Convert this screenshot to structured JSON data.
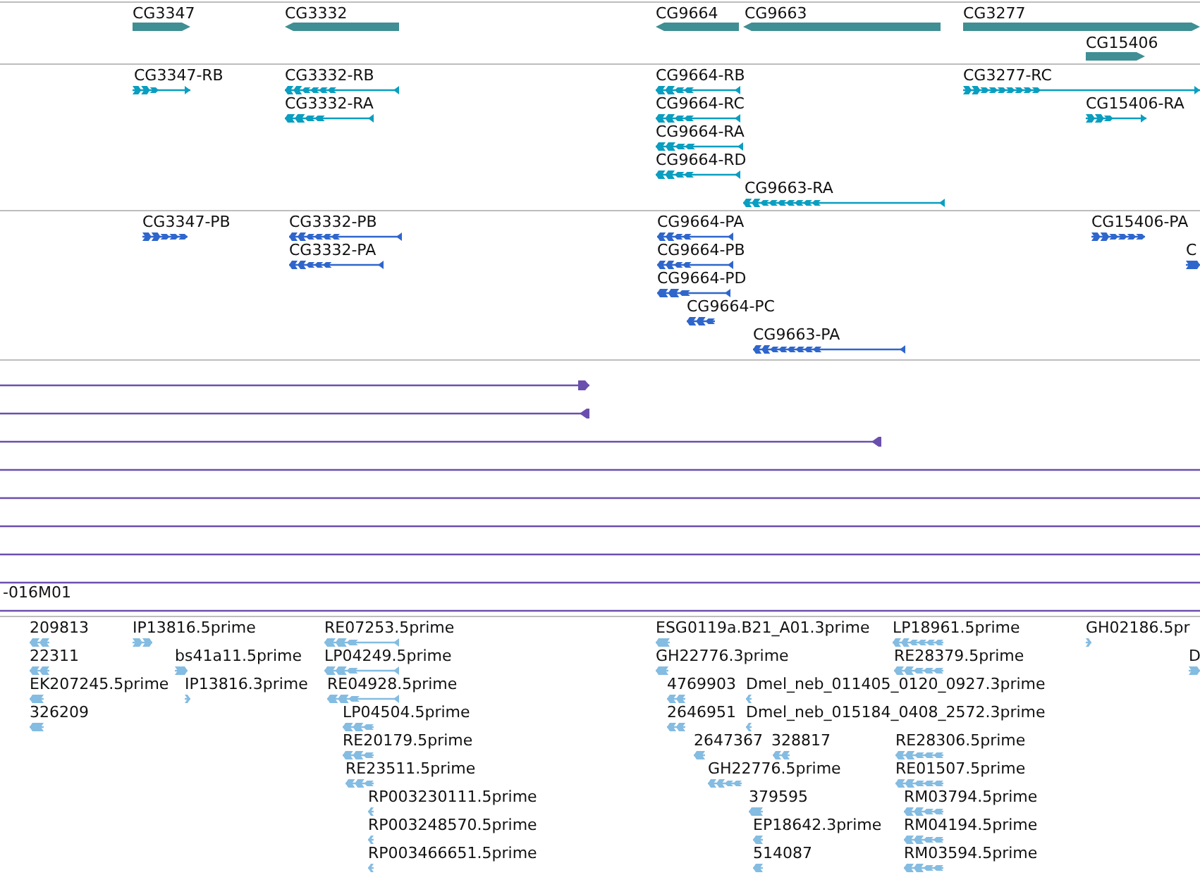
{
  "tracks": [
    {
      "kind": "gene",
      "features": [
        {
          "label": "CG3347",
          "reverse": false
        },
        {
          "label": "CG3332",
          "reverse": true
        },
        {
          "label": "CG9664",
          "reverse": true
        },
        {
          "label": "CG9663",
          "reverse": true
        },
        {
          "label": "CG3277",
          "reverse": false
        },
        {
          "label": "CG15406",
          "reverse": false
        }
      ]
    },
    {
      "kind": "transcript",
      "features": [
        {
          "label": "CG3347-RB",
          "reverse": false
        },
        {
          "label": "CG3332-RB",
          "reverse": true
        },
        {
          "label": "CG3332-RA",
          "reverse": true
        },
        {
          "label": "CG9664-RB",
          "reverse": true
        },
        {
          "label": "CG9664-RC",
          "reverse": true
        },
        {
          "label": "CG9664-RA",
          "reverse": true
        },
        {
          "label": "CG9664-RD",
          "reverse": true
        },
        {
          "label": "CG9663-RA",
          "reverse": true
        },
        {
          "label": "CG3277-RC",
          "reverse": false
        },
        {
          "label": "CG15406-RA",
          "reverse": false
        }
      ]
    },
    {
      "kind": "protein",
      "features": [
        {
          "label": "CG3347-PB",
          "reverse": false
        },
        {
          "label": "CG3332-PB",
          "reverse": true
        },
        {
          "label": "CG3332-PA",
          "reverse": true
        },
        {
          "label": "CG9664-PA",
          "reverse": true
        },
        {
          "label": "CG9664-PB",
          "reverse": true
        },
        {
          "label": "CG9664-PD",
          "reverse": true
        },
        {
          "label": "CG9664-PC",
          "reverse": true
        },
        {
          "label": "CG9663-PA",
          "reverse": true
        },
        {
          "label": "CG15406-PA",
          "reverse": false
        },
        {
          "label": "C",
          "reverse": false
        }
      ]
    },
    {
      "kind": "alignment",
      "features": [
        {
          "end_shown": true,
          "reverse": false
        },
        {
          "end_shown": true,
          "reverse": true
        },
        {
          "end_shown": true,
          "reverse": true
        },
        {
          "end_shown": false
        },
        {
          "end_shown": false
        },
        {
          "end_shown": false
        },
        {
          "end_shown": false
        },
        {
          "end_shown": false
        },
        {
          "label": "-016M01",
          "end_shown": false
        }
      ]
    },
    {
      "kind": "est",
      "features": [
        {
          "label": "209813",
          "reverse": true
        },
        {
          "label": "22311",
          "reverse": true
        },
        {
          "label": "EK207245.5prime",
          "reverse": true
        },
        {
          "label": "326209",
          "reverse": true
        },
        {
          "label": "IP13816.5prime",
          "reverse": false
        },
        {
          "label": "bs41a11.5prime",
          "reverse": false
        },
        {
          "label": "IP13816.3prime",
          "reverse": false
        },
        {
          "label": "RE07253.5prime",
          "reverse": true
        },
        {
          "label": "LP04249.5prime",
          "reverse": true
        },
        {
          "label": "RE04928.5prime",
          "reverse": true
        },
        {
          "label": "LP04504.5prime",
          "reverse": true
        },
        {
          "label": "RE20179.5prime",
          "reverse": true
        },
        {
          "label": "RE23511.5prime",
          "reverse": true
        },
        {
          "label": "RP003230111.5prime",
          "reverse": true
        },
        {
          "label": "RP003248570.5prime",
          "reverse": true
        },
        {
          "label": "RP003466651.5prime",
          "reverse": true
        },
        {
          "label": "ESG0119a.B21_A01.3prime",
          "reverse": true
        },
        {
          "label": "GH22776.3prime",
          "reverse": true
        },
        {
          "label": "4769903",
          "reverse": true
        },
        {
          "label": "Dmel_neb_011405_0120_0927.3prime",
          "reverse": true
        },
        {
          "label": "2646951",
          "reverse": true
        },
        {
          "label": "Dmel_neb_015184_0408_2572.3prime",
          "reverse": true
        },
        {
          "label": "2647367",
          "reverse": true
        },
        {
          "label": "328817",
          "reverse": true
        },
        {
          "label": "GH22776.5prime",
          "reverse": true
        },
        {
          "label": "379595",
          "reverse": true
        },
        {
          "label": "EP18642.3prime",
          "reverse": true
        },
        {
          "label": "514087",
          "reverse": true
        },
        {
          "label": "LP18961.5prime",
          "reverse": true
        },
        {
          "label": "RE28379.5prime",
          "reverse": true
        },
        {
          "label": "RE28306.5prime",
          "reverse": true
        },
        {
          "label": "RE01507.5prime",
          "reverse": true
        },
        {
          "label": "RM03794.5prime",
          "reverse": true
        },
        {
          "label": "RM04194.5prime",
          "reverse": true
        },
        {
          "label": "RM03594.5prime",
          "reverse": true
        },
        {
          "label": "GH02186.5pr",
          "reverse": false
        },
        {
          "label": "D",
          "reverse": false
        }
      ]
    }
  ]
}
